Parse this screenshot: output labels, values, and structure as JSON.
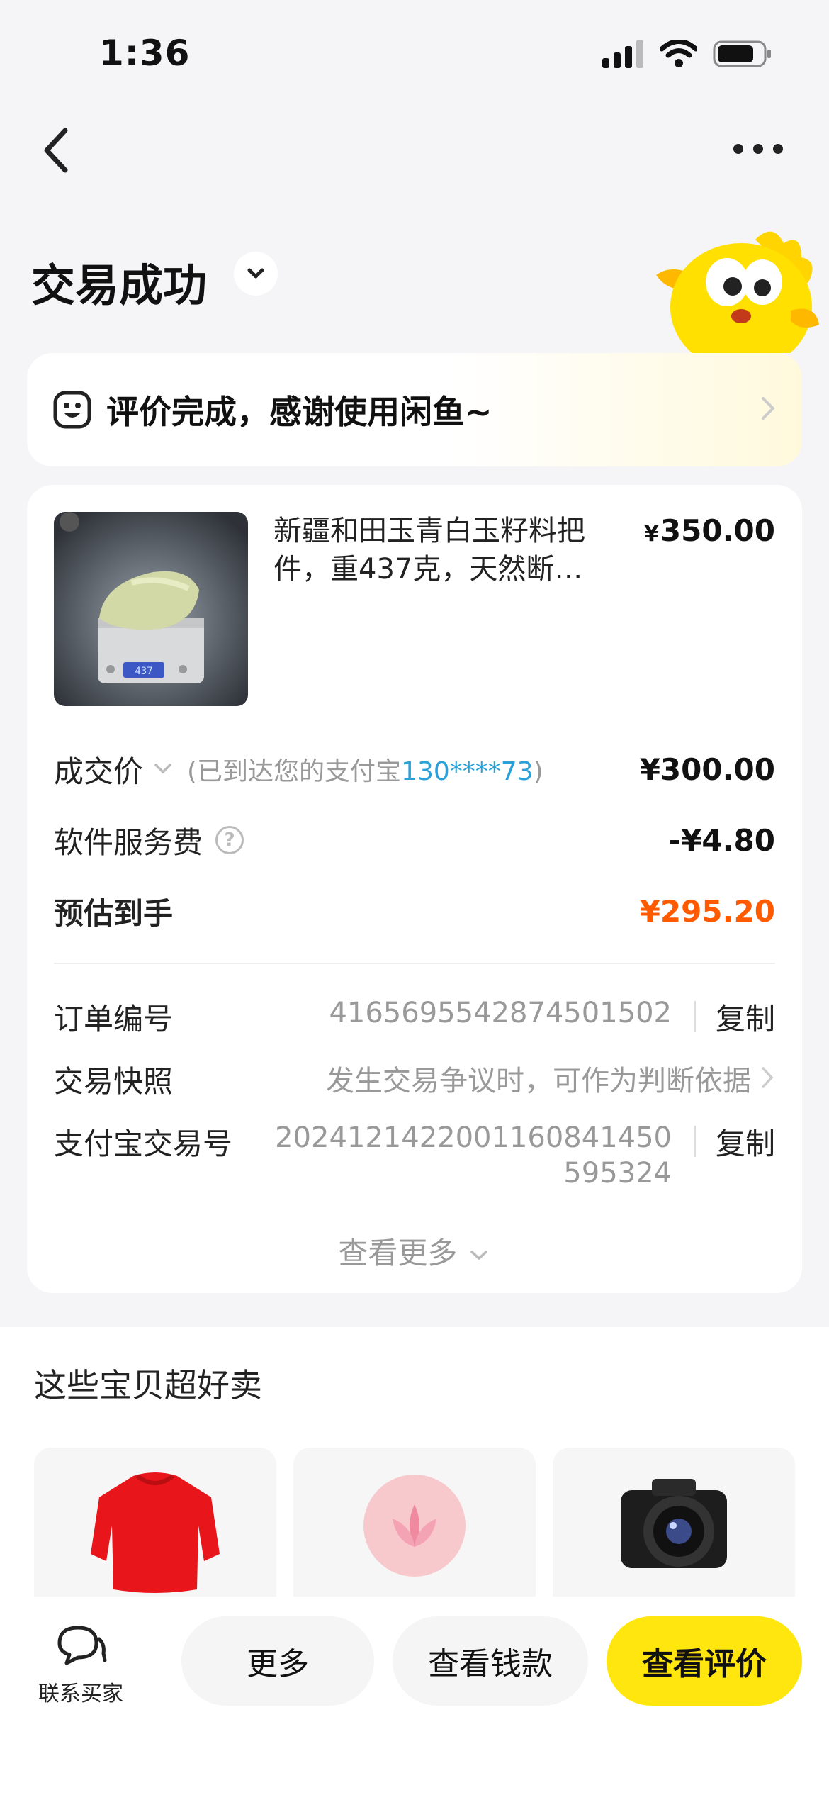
{
  "status_bar": {
    "time": "1:36"
  },
  "header": {
    "title": "交易成功"
  },
  "review_banner": {
    "label": "评价完成，感谢使用闲鱼~"
  },
  "product": {
    "title": "新疆和田玉青白玉籽料把件，重437克，天然断…",
    "price_symbol": "¥",
    "price": "350.00",
    "scale_reading": "437"
  },
  "price_rows": {
    "deal_label": "成交价",
    "deal_note_prefix": "(已到达您的支付宝",
    "deal_note_account": "130****73",
    "deal_note_suffix": ")",
    "deal_value": "¥300.00",
    "fee_label": "软件服务费",
    "fee_value": "-¥4.80",
    "estimate_label": "预估到手",
    "estimate_value": "¥295.20",
    "estimate_color": "#ff5a00"
  },
  "order_info": {
    "order_no_label": "订单编号",
    "order_no": "4165695542874501502",
    "copy_label": "复制",
    "snapshot_label": "交易快照",
    "snapshot_hint": "发生交易争议时，可作为判断依据",
    "alipay_label": "支付宝交易号",
    "alipay_no_line1": "202412142200116084145​0",
    "alipay_no_line2": "595324",
    "see_more": "查看更多"
  },
  "recommendations": {
    "title": "这些宝贝超好卖",
    "items": [
      {
        "icon": "red-sweater"
      },
      {
        "icon": "pink-lotus-ball"
      },
      {
        "icon": "camera"
      }
    ]
  },
  "bottom_bar": {
    "contact_label": "联系买家",
    "more": "更多",
    "view_funds": "查看钱款",
    "view_review": "查看评价",
    "accent": "#ffe60f"
  }
}
